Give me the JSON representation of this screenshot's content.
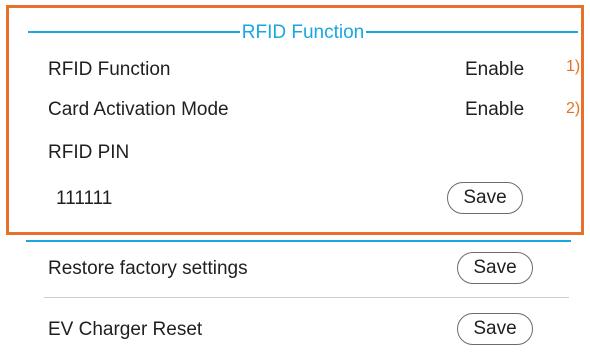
{
  "rfid_section": {
    "title": "RFID Function",
    "rows": [
      {
        "label": "RFID Function",
        "value": "Enable",
        "annotation": "1)"
      },
      {
        "label": "Card Activation Mode",
        "value": "Enable",
        "annotation": "2)"
      }
    ],
    "pin_label": "RFID PIN",
    "pin_value": "111111",
    "save_label": "Save"
  },
  "settings": [
    {
      "label": "Restore factory settings",
      "button": "Save"
    },
    {
      "label": "EV Charger Reset",
      "button": "Save"
    }
  ],
  "colors": {
    "accent_blue": "#1aa6e0",
    "highlight_orange": "#e8702a"
  }
}
